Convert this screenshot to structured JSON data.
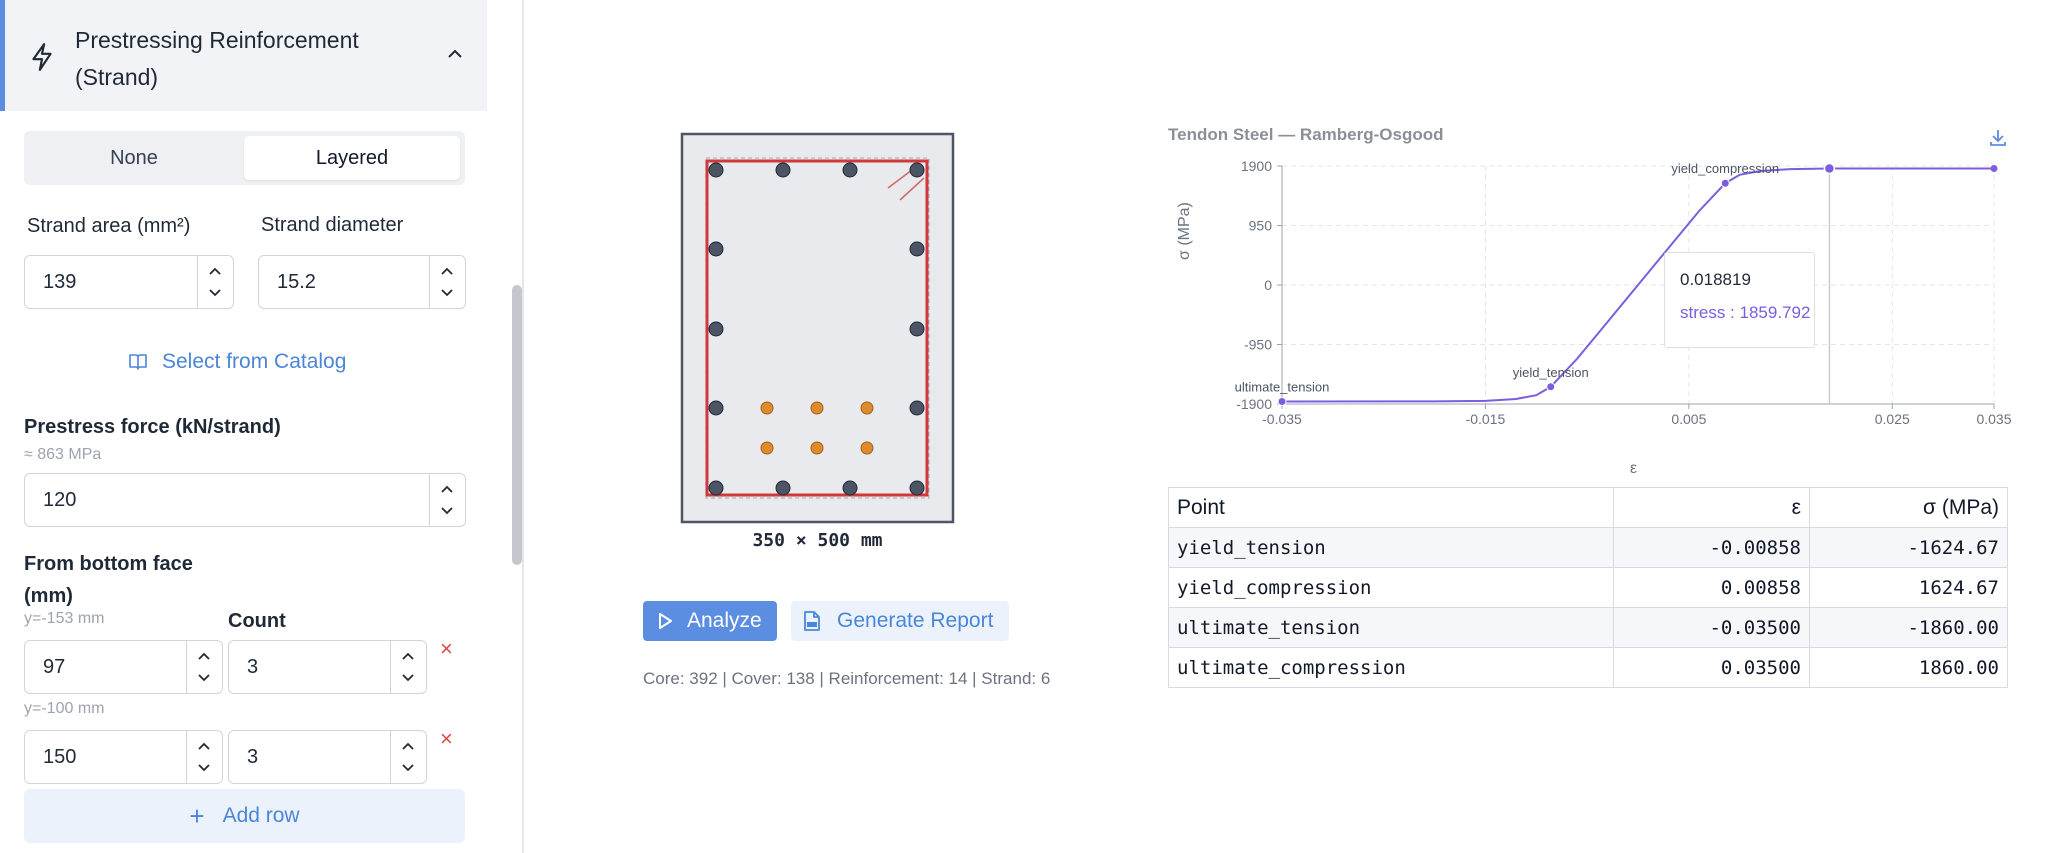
{
  "sidebar": {
    "section_title": "Prestressing Reinforcement (Strand)",
    "mode_options": [
      "None",
      "Layered"
    ],
    "selected_mode": "Layered",
    "strand_area": {
      "label": "Strand area (mm²)",
      "value": "139"
    },
    "strand_diameter": {
      "label": "Strand diameter",
      "value": "15.2"
    },
    "catalog_link": "Select from Catalog",
    "prestress_force": {
      "label": "Prestress force (kN/strand)",
      "hint": "≈ 863 MPa",
      "value": "120"
    },
    "layers_header": {
      "from_bottom_label": "From bottom face (mm)",
      "count_label": "Count"
    },
    "layers": [
      {
        "hint": "y=-153 mm",
        "from_bottom": "97",
        "count": "3"
      },
      {
        "hint": "y=-100 mm",
        "from_bottom": "150",
        "count": "3"
      }
    ],
    "delete_glyph": "×",
    "add_row": "Add row"
  },
  "section": {
    "dimensions": "350 × 500 mm",
    "analyze_label": "Analyze",
    "report_label": "Generate Report",
    "stats": "Core: 392 | Cover: 138 | Reinforcement: 14 | Strand: 6"
  },
  "chart": {
    "title": "Tendon Steel — Ramberg-Osgood",
    "tooltip": {
      "x": "0.018819",
      "y": "stress : 1859.792"
    }
  },
  "chart_data": {
    "type": "line",
    "title": "Tendon Steel — Ramberg-Osgood",
    "xlabel": "ε",
    "ylabel": "σ (MPa)",
    "xlim": [
      -0.035,
      0.035
    ],
    "ylim": [
      -1900,
      1900
    ],
    "xticks": [
      "-0.035",
      "-0.015",
      "0.005",
      "0.025",
      "0.035"
    ],
    "xtick_values": [
      -0.035,
      -0.015,
      0.005,
      0.025,
      0.035
    ],
    "yticks": [
      "1900",
      "950",
      "0",
      "-950",
      "-1900"
    ],
    "ytick_values": [
      1900,
      950,
      0,
      -950,
      -1900
    ],
    "grid": true,
    "color": "#7c5ce0",
    "series": [
      {
        "x": [
          -0.035,
          -0.02,
          -0.015,
          -0.012,
          -0.01,
          -0.00858,
          -0.006,
          -0.003,
          0,
          0.003,
          0.006,
          0.00858,
          0.01,
          0.012,
          0.015,
          0.018819,
          0.025,
          0.035
        ],
        "y": [
          -1860,
          -1858,
          -1850,
          -1820,
          -1760,
          -1624.67,
          -1180,
          -590,
          0,
          590,
          1180,
          1624.67,
          1760,
          1820,
          1850,
          1859.792,
          1860,
          1860
        ]
      }
    ],
    "annotations": [
      {
        "label": "ultimate_tension",
        "x": -0.035,
        "y": -1860
      },
      {
        "label": "yield_tension",
        "x": -0.00858,
        "y": -1624.67
      },
      {
        "label": "yield_compression",
        "x": 0.00858,
        "y": 1624.67
      }
    ],
    "highlight": {
      "x": 0.018819,
      "y": 1859.792
    }
  },
  "table": {
    "headers": [
      "Point",
      "ε",
      "σ (MPa)"
    ],
    "rows": [
      [
        "yield_tension",
        "-0.00858",
        "-1624.67"
      ],
      [
        "yield_compression",
        "0.00858",
        "1624.67"
      ],
      [
        "ultimate_tension",
        "-0.03500",
        "-1860.00"
      ],
      [
        "ultimate_compression",
        "0.03500",
        "1860.00"
      ]
    ]
  }
}
